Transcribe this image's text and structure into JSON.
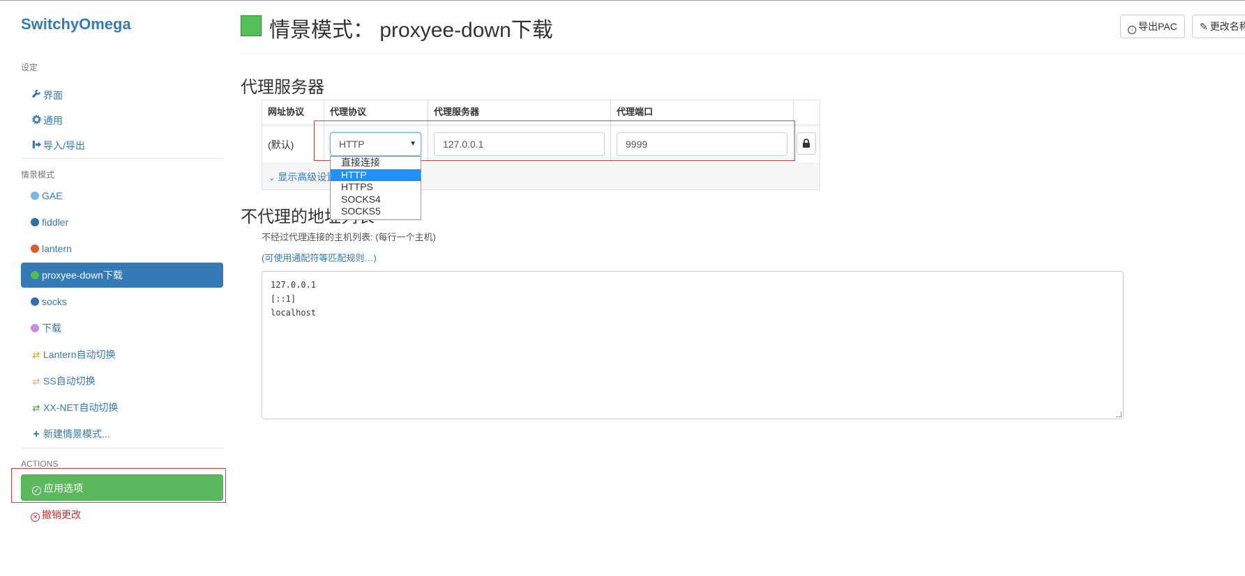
{
  "sidebar": {
    "brand": "SwitchyOmega",
    "settings_heading": "设定",
    "settings_items": [
      {
        "label": "界面",
        "icon": "wrench-icon"
      },
      {
        "label": "通用",
        "icon": "gear-icon"
      },
      {
        "label": "导入/导出",
        "icon": "import-export-icon"
      }
    ],
    "profiles_heading": "情景模式",
    "profiles": [
      {
        "label": "GAE",
        "icon": "globe-icon",
        "color": "#7fb4e8"
      },
      {
        "label": "fiddler",
        "icon": "globe-icon",
        "color": "#2f6ea8"
      },
      {
        "label": "lantern",
        "icon": "globe-icon",
        "color": "#e05a2a"
      },
      {
        "label": "proxyee-down下载",
        "icon": "globe-icon",
        "color": "#54bf54",
        "active": true
      },
      {
        "label": "socks",
        "icon": "globe-icon",
        "color": "#2f6ea8"
      },
      {
        "label": "下载",
        "icon": "globe-icon",
        "color": "#c78ee0"
      },
      {
        "label": "Lantern自动切换",
        "icon": "auto-switch-icon",
        "color": "#c9a400"
      },
      {
        "label": "SS自动切换",
        "icon": "auto-switch-icon",
        "color": "#f0a080"
      },
      {
        "label": "XX-NET自动切换",
        "icon": "auto-switch-icon",
        "color": "#3aa03a"
      }
    ],
    "new_profile": "新建情景模式...",
    "actions_heading": "ACTIONS",
    "apply_label": "应用选项",
    "discard_label": "撤销更改"
  },
  "header": {
    "title": "情景模式： proxyee-down下载",
    "swatch_color": "#54bf54",
    "export_pac": "导出PAC",
    "rename": "更改名称"
  },
  "proxy": {
    "heading": "代理服务器",
    "columns": [
      "网址协议",
      "代理协议",
      "代理服务器",
      "代理端口"
    ],
    "row_scheme": "(默认)",
    "protocol": "HTTP",
    "server": "127.0.0.1",
    "port": "9999",
    "advanced_link": "显示高级设置",
    "protocol_options": [
      "直接连接",
      "HTTP",
      "HTTPS",
      "SOCKS4",
      "SOCKS5"
    ],
    "protocol_selected": "HTTP"
  },
  "bypass": {
    "heading": "不代理的地址列表",
    "help": "不经过代理连接的主机列表: (每行一个主机)",
    "wildcard_link": "(可使用通配符等匹配规则…)",
    "lines": [
      "127.0.0.1",
      "[::1]",
      "localhost"
    ]
  }
}
